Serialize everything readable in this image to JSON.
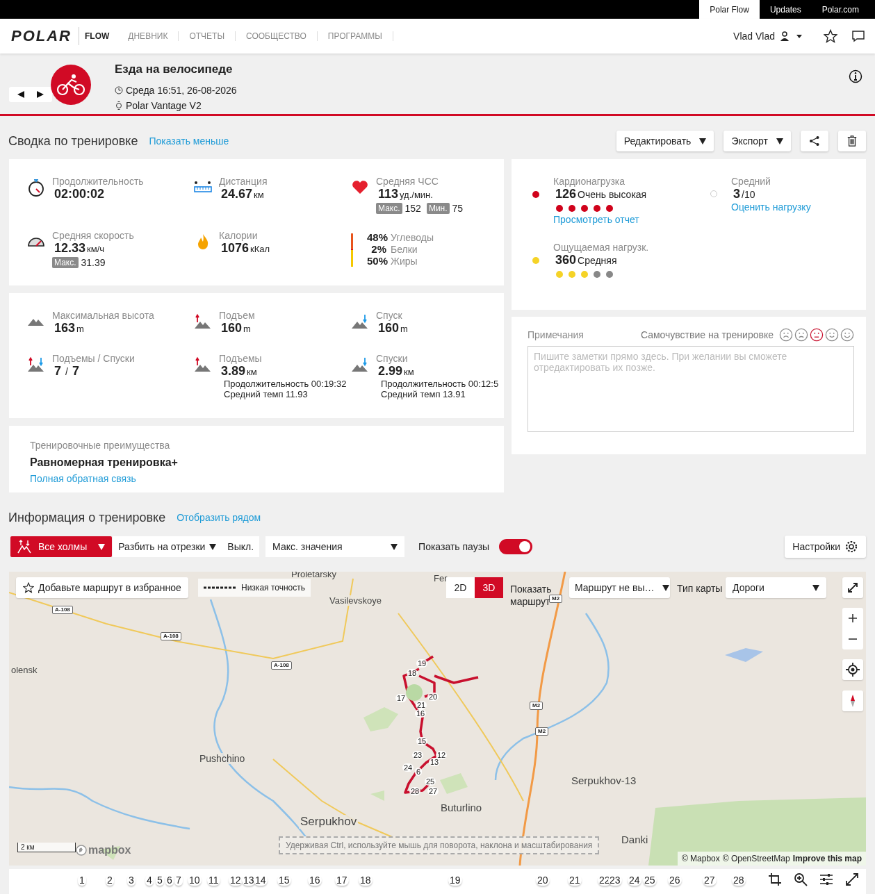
{
  "top_bar": {
    "links": [
      {
        "label": "Polar Flow",
        "selected": true
      },
      {
        "label": "Updates",
        "selected": false
      },
      {
        "label": "Polar.com",
        "selected": false
      }
    ]
  },
  "nav": {
    "logo": "POLAR",
    "product": "FLOW",
    "items": [
      "ДНЕВНИК",
      "ОТЧЕТЫ",
      "СООБЩЕСТВО",
      "ПРОГРАММЫ"
    ],
    "user": "Vlad Vlad"
  },
  "activity": {
    "title": "Езда на велосипеде",
    "datetime": "Среда 16:51, 26-08-2026",
    "device": "Polar Vantage V2"
  },
  "summary": {
    "title": "Сводка по тренировке",
    "toggle_link": "Показать меньше",
    "buttons": [
      {
        "kind": "dropdown",
        "label": "Редактировать"
      },
      {
        "kind": "dropdown",
        "label": "Экспорт"
      },
      {
        "kind": "share"
      },
      {
        "kind": "delete"
      }
    ]
  },
  "main_stats": [
    {
      "kind": "duration",
      "label": "Продолжительность",
      "value": "02:00:02"
    },
    {
      "kind": "distance",
      "label": "Дистанция",
      "value": "24.67",
      "unit": "км"
    },
    {
      "kind": "heart",
      "label": "Средняя ЧСС",
      "value": "113",
      "unit": "уд./мин.",
      "extra": [
        {
          "tag": "Макс.",
          "value": "152"
        },
        {
          "tag": "Мин.",
          "value": "75"
        }
      ]
    },
    {
      "kind": "speed",
      "label": "Средняя скорость",
      "value": "12.33",
      "unit": "км/ч",
      "extra": [
        {
          "tag": "Макс.",
          "value": "31.39"
        }
      ]
    },
    {
      "kind": "calories",
      "label": "Калории",
      "value": "1076",
      "unit": "кКал"
    },
    {
      "kind": "energy",
      "sources": [
        {
          "percent": "48%",
          "label": "Углеводы",
          "color": "#e8541c",
          "level": 0.48
        },
        {
          "percent": "2%",
          "label": "Белки",
          "color": "#d0021b",
          "level": 0.02
        },
        {
          "percent": "50%",
          "label": "Жиры",
          "color": "#f5c800",
          "level": 0.5
        }
      ]
    }
  ],
  "elevation_stats": [
    {
      "kind": "max-altitude",
      "label": "Максимальная высота",
      "value": "163",
      "unit": "m"
    },
    {
      "kind": "ascent",
      "label": "Подъем",
      "value": "160",
      "unit": "m"
    },
    {
      "kind": "descent",
      "label": "Спуск",
      "value": "160",
      "unit": "m"
    },
    {
      "kind": "updown",
      "label": "Подъемы / Спуски",
      "value": "7",
      "separator": "/",
      "value2": "7"
    },
    {
      "kind": "climbs",
      "label": "Подъемы",
      "value": "3.89",
      "unit": "км",
      "details": [
        "Продолжительность 00:19:32",
        "Средний темп 11.93"
      ]
    },
    {
      "kind": "descents",
      "label": "Спуски",
      "value": "2.99",
      "unit": "км",
      "details": [
        "Продолжительность 00:12:5",
        "Средний темп 13.91"
      ]
    }
  ],
  "benefit": {
    "label": "Тренировочные преимущества",
    "value": "Равномерная тренировка+",
    "link": "Полная обратная связь"
  },
  "load": {
    "items": [
      {
        "kind": "load",
        "label": "Кардионагрузка",
        "value": "126",
        "level_text": "Очень высокая",
        "color": "#d0021b",
        "stars": 5,
        "link": "Просмотреть отчет"
      },
      {
        "kind": "rating",
        "label": "Средний",
        "value": "3",
        "suffix": "/10",
        "link": "Оценить нагрузку"
      },
      {
        "kind": "load",
        "label": "Ощущаемая нагрузк.",
        "value": "360",
        "level_text": "Средняя",
        "color": "#f5d327",
        "stars": 3
      }
    ]
  },
  "notes": {
    "label": "Примечания",
    "feeling_label": "Самочувствие на тренировке",
    "feelings": [
      {
        "kind": "very-sad",
        "selected": false
      },
      {
        "kind": "sad",
        "selected": false
      },
      {
        "kind": "neutral",
        "selected": true
      },
      {
        "kind": "happy",
        "selected": false
      },
      {
        "kind": "very-happy",
        "selected": false
      }
    ],
    "placeholder": "Пишите заметки прямо здесь. При желании вы сможете отредактировать их позже."
  },
  "info": {
    "title": "Информация о тренировке",
    "link": "Отобразить рядом",
    "hills_button": "Все холмы",
    "segments": "Разбить на отрезки",
    "segments_value": "Выкл.",
    "stat_select": "Макс. значения",
    "pauses_label": "Показать паузы",
    "pauses_on": true,
    "settings": "Настройки"
  },
  "map": {
    "favorite": "Добавьте маршрут в избранное",
    "accuracy": "Низкая точность",
    "modes": [
      {
        "label": "2D",
        "selected": false
      },
      {
        "label": "3D",
        "selected": true
      }
    ],
    "show_route": "Показать маршрут",
    "route_select": "Маршрут не вы…",
    "map_type_label": "Тип карты",
    "map_type": "Дороги",
    "places": [
      "Proletarsky",
      "Fer",
      "Vasilevskoye",
      "olensk",
      "Pushchino",
      "Serpukhov-13",
      "Buturlino",
      "Serpukhov",
      "Danki"
    ],
    "road_signs": [
      "A-108",
      "A-108",
      "A-108",
      "M2",
      "M2",
      "M2"
    ],
    "route_markers": [
      "19",
      "18",
      "17",
      "20",
      "21",
      "16",
      "15",
      "12",
      "13",
      "23",
      "24",
      "6",
      "25",
      "28",
      "27"
    ],
    "scale": "2 км",
    "logo": "mapbox",
    "hint": "Удерживая Ctrl, используйте мышь для поворота, наклона и масштабирования",
    "attribution": [
      "© Mapbox",
      "© OpenStreetMap",
      "Improve this map"
    ]
  },
  "laps": [
    "1",
    "2",
    "3",
    "4",
    "5",
    "6",
    "7",
    "10",
    "11",
    "12",
    "13",
    "14",
    "15",
    "16",
    "17",
    "18",
    "19",
    "20",
    "21",
    "22",
    "23",
    "24",
    "25",
    "26",
    "27",
    "28"
  ]
}
